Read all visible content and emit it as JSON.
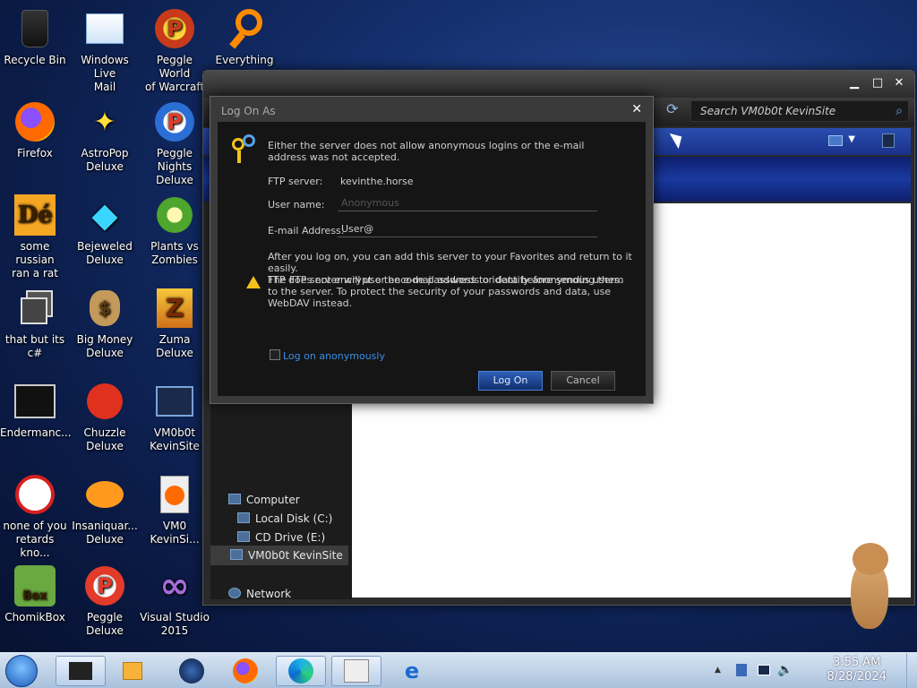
{
  "desktop": {
    "icons": [
      {
        "label": "Recycle Bin",
        "icon": "recycle-bin-icon"
      },
      {
        "label": "Windows Live\nMail",
        "icon": "mail-icon"
      },
      {
        "label": "Peggle World\nof Warcraft ...",
        "icon": "peggle-icon"
      },
      {
        "label": "Everything",
        "icon": "search-icon"
      },
      {
        "label": "Firefox",
        "icon": "firefox-icon"
      },
      {
        "label": "AstroPop\nDeluxe",
        "icon": "astropop-icon"
      },
      {
        "label": "Peggle Nights\nDeluxe",
        "icon": "peggle-icon"
      },
      {
        "label": "some russian\nran a rat",
        "icon": "de-icon"
      },
      {
        "label": "Bejeweled\nDeluxe",
        "icon": "gem-icon"
      },
      {
        "label": "Plants vs\nZombies",
        "icon": "plant-icon"
      },
      {
        "label": "that but its c#",
        "icon": "windows-stack-icon"
      },
      {
        "label": "Big Money\nDeluxe",
        "icon": "money-bag-icon"
      },
      {
        "label": "Zuma Deluxe",
        "icon": "zuma-icon"
      },
      {
        "label": "Endermanc...",
        "icon": "terminal-icon"
      },
      {
        "label": "Chuzzle\nDeluxe",
        "icon": "chuzzle-icon"
      },
      {
        "label": "VM0b0t\nKevinSite",
        "icon": "monitor-icon"
      },
      {
        "label": "none of you\nretards kno...",
        "icon": "dragon-icon"
      },
      {
        "label": "Insaniquar...\nDeluxe",
        "icon": "fish-icon"
      },
      {
        "label": "VM0\nKevinSi...",
        "icon": "firefox-file-icon"
      },
      {
        "label": "ChomikBox",
        "icon": "hamster-icon"
      },
      {
        "label": "Peggle Deluxe",
        "icon": "peggle-icon"
      },
      {
        "label": "Visual Studio\n2015",
        "icon": "visual-studio-icon"
      }
    ]
  },
  "explorer": {
    "search_placeholder": "Search VM0b0t KevinSite",
    "nav": {
      "computer": "Computer",
      "local_disk": "Local Disk (C:)",
      "cd_drive": "CD Drive (E:)",
      "site": "VM0b0t KevinSite",
      "network": "Network"
    }
  },
  "dialog": {
    "title": "Log On As",
    "message": "Either the server does not allow anonymous logins or the e-mail address was not accepted.",
    "ftp_server_label": "FTP server:",
    "ftp_server_value": "kevinthe.horse",
    "user_name_label": "User name:",
    "user_name_value": "Anonymous",
    "email_label": "E-mail Address:",
    "email_value": "User@",
    "info_text": "After you log on, you can add this server to your Favorites and return to it easily.\nThe FTP server will use the e-mail address to identify anonymous users.",
    "warning_text": "FTP does not encrypt or encode passwords or data before sending them to the server.  To protect the security of your passwords and data, use WebDAV instead.",
    "anon_label": "Log on anonymously",
    "logon_button": "Log On",
    "cancel_button": "Cancel"
  },
  "taskbar": {
    "time": "3:55 AM",
    "date": "8/28/2024"
  }
}
